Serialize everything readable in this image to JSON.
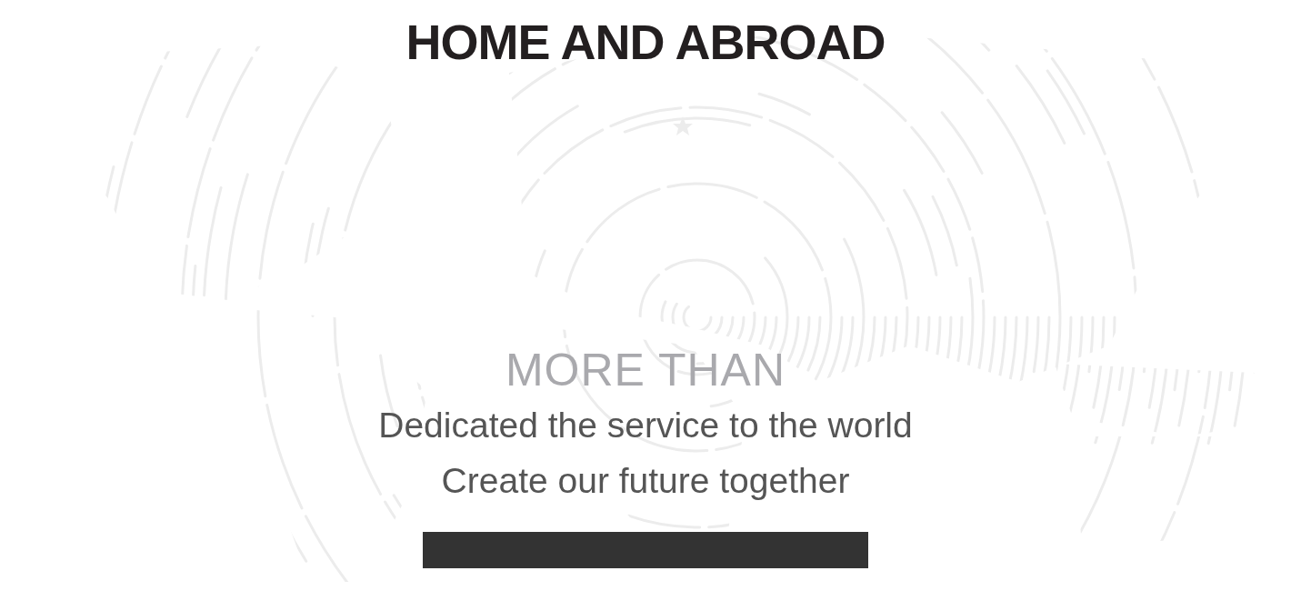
{
  "heading": "HOME AND ABROAD",
  "subheading": "MORE THAN",
  "lines": [
    "Dedicated the service to the world",
    "Create our future together"
  ]
}
